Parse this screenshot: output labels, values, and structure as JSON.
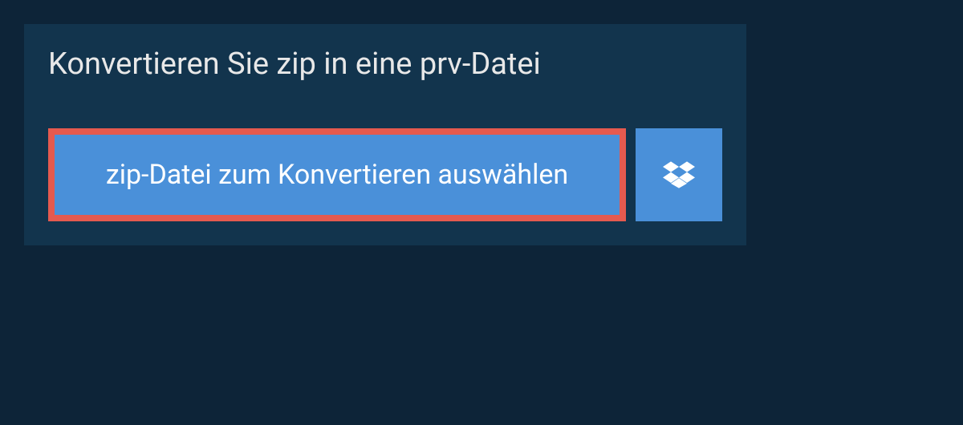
{
  "header": {
    "title": "Konvertieren Sie zip in eine prv-Datei"
  },
  "actions": {
    "select_file_label": "zip-Datei zum Konvertieren auswählen"
  },
  "colors": {
    "background": "#0d2438",
    "panel": "#12344d",
    "button_primary": "#4a90d9",
    "highlight_border": "#e55a4f",
    "text_light": "#e8e8e8"
  }
}
